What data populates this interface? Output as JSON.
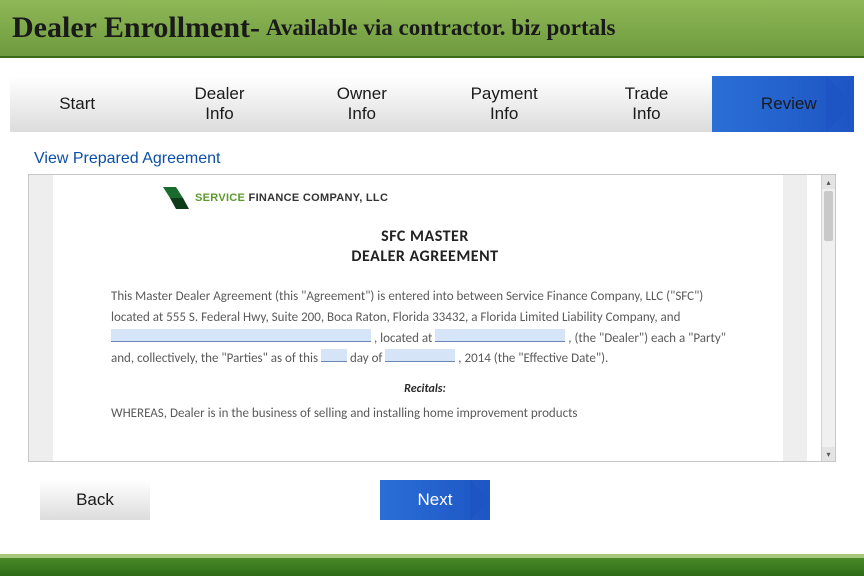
{
  "header": {
    "title": "Dealer Enrollment-",
    "subtitle": "Available via contractor. biz portals"
  },
  "steps": [
    {
      "label": "Start",
      "style": "grey"
    },
    {
      "label": "Dealer\nInfo",
      "style": "grey"
    },
    {
      "label": "Owner\nInfo",
      "style": "grey"
    },
    {
      "label": "Payment\nInfo",
      "style": "grey"
    },
    {
      "label": "Trade\nInfo",
      "style": "grey"
    },
    {
      "label": "Review",
      "style": "blue"
    }
  ],
  "section_label": "View Prepared Agreement",
  "document": {
    "logo_text_green": "SERVICE",
    "logo_text_rest": " FINANCE COMPANY, LLC",
    "heading_line1": "SFC MASTER",
    "heading_line2": "DEALER AGREEMENT",
    "para1_prefix": "This Master Dealer Agreement (this \"Agreement\") is entered into between Service Finance Company, LLC (\"SFC\") located at 555 S. Federal Hwy, Suite 200, Boca Raton, Florida 33432, a Florida Limited Liability Company, and ",
    "para1_mid": ", located at ",
    "para1_after_dealer": ", (the \"Dealer\") each a \"Party\" and, collectively, the \"Parties\" as of this ",
    "para1_dayof": " day of ",
    "para1_year": ", 2014 (the \"Effective Date\").",
    "recitals": "Recitals:",
    "whereas": "WHEREAS, Dealer is in the business of selling and installing home improvement products"
  },
  "buttons": {
    "back": "Back",
    "next": "Next"
  }
}
